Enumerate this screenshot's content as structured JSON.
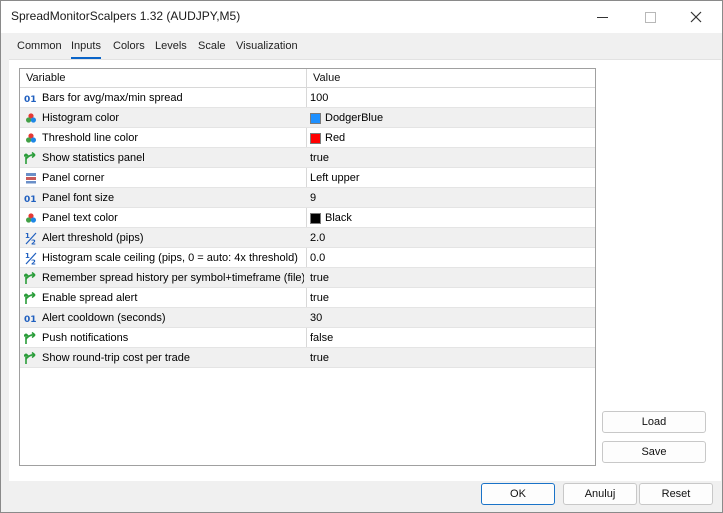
{
  "window": {
    "title": "SpreadMonitorScalpers 1.32 (AUDJPY,M5)"
  },
  "tabs": [
    "Common",
    "Inputs",
    "Colors",
    "Levels",
    "Scale",
    "Visualization"
  ],
  "active_tab": "Inputs",
  "grid": {
    "header_variable": "Variable",
    "header_value": "Value",
    "rows": [
      {
        "icon": "integer-icon",
        "name": "Bars for avg/max/min spread",
        "value": "100"
      },
      {
        "icon": "color-icon",
        "name": "Histogram color",
        "value": "DodgerBlue",
        "swatch": "#1e90ff"
      },
      {
        "icon": "color-icon",
        "name": "Threshold line color",
        "value": "Red",
        "swatch": "#ff0000"
      },
      {
        "icon": "bool-icon",
        "name": "Show statistics panel",
        "value": "true"
      },
      {
        "icon": "enum-icon",
        "name": "Panel corner",
        "value": "Left upper"
      },
      {
        "icon": "integer-icon",
        "name": "Panel font size",
        "value": "9"
      },
      {
        "icon": "color-icon",
        "name": "Panel text color",
        "value": "Black",
        "swatch": "#000000"
      },
      {
        "icon": "double-icon",
        "name": "Alert threshold (pips)",
        "value": "2.0"
      },
      {
        "icon": "double-icon",
        "name": "Histogram scale ceiling (pips, 0 = auto: 4x threshold)",
        "value": "0.0"
      },
      {
        "icon": "bool-icon",
        "name": "Remember spread history per symbol+timeframe (file)",
        "value": "true"
      },
      {
        "icon": "bool-icon",
        "name": "Enable spread alert",
        "value": "true"
      },
      {
        "icon": "integer-icon",
        "name": "Alert cooldown (seconds)",
        "value": "30"
      },
      {
        "icon": "bool-icon",
        "name": "Push notifications",
        "value": "false"
      },
      {
        "icon": "bool-icon",
        "name": "Show round-trip cost per trade",
        "value": "true"
      }
    ]
  },
  "side_buttons": {
    "load": "Load",
    "save": "Save"
  },
  "footer_buttons": {
    "ok": "OK",
    "cancel": "Anuluj",
    "reset": "Reset"
  },
  "colors": {
    "accent": "#0a64c8",
    "bool_icon": "#2a9d3a",
    "integer_icon": "#1f5fbf"
  }
}
